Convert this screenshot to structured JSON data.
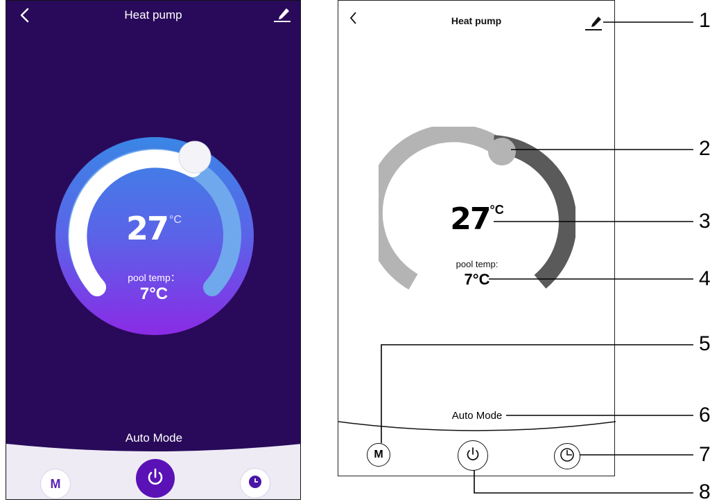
{
  "app": {
    "title": "Heat pump",
    "set_temp_value": "27",
    "set_temp_unit": "°C",
    "pool_temp_label": "pool temp：",
    "pool_temp_value": "7°C",
    "mode_label": "Auto Mode",
    "mode_button_label": "M"
  },
  "diagram": {
    "title": "Heat pump",
    "set_temp_value": "27",
    "set_temp_unit": "°C",
    "pool_temp_label": "pool temp:",
    "pool_temp_value": "7°C",
    "mode_label": "Auto Mode",
    "mode_button_label": "M"
  },
  "callouts": [
    "1",
    "2",
    "3",
    "4",
    "5",
    "6",
    "7",
    "8"
  ],
  "colors": {
    "app_background": "#290a5a",
    "dial_gradient_top": "#3a7fe0",
    "dial_gradient_bottom": "#8a2be2",
    "power_button": "#5a12b6",
    "accent_text": "#5b22b6"
  },
  "icons": [
    "back-arrow-icon",
    "edit-pen-icon",
    "power-icon",
    "clock-icon"
  ]
}
